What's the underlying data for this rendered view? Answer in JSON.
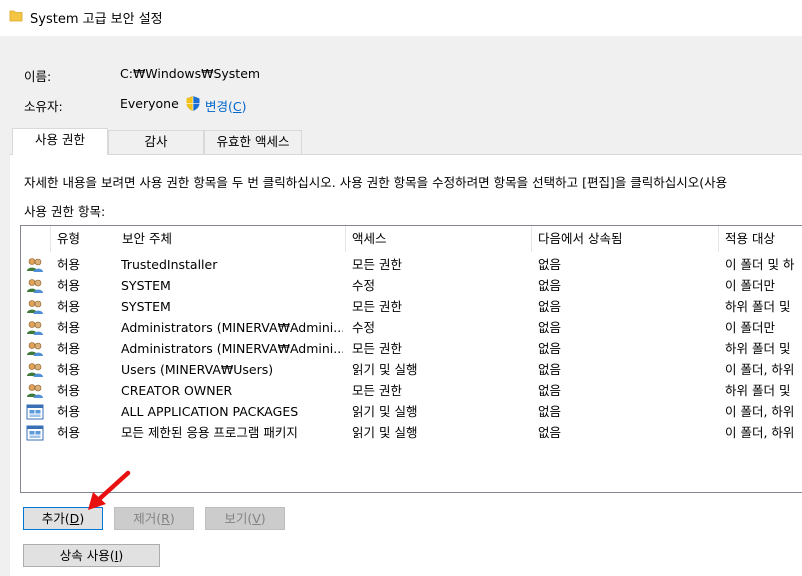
{
  "window": {
    "title": "System 고급 보안 설정"
  },
  "fields": {
    "name_label": "이름:",
    "name_value": "C:₩Windows₩System",
    "owner_label": "소유자:",
    "owner_value": "Everyone",
    "change_text": "변경(",
    "change_key": "C",
    "change_end": ")"
  },
  "tabs": [
    {
      "label": "사용 권한",
      "active": true
    },
    {
      "label": "감사",
      "active": false
    },
    {
      "label": "유효한 액세스",
      "active": false
    }
  ],
  "instruction": "자세한 내용을 보려면 사용 권한 항목을 두 번 클릭하십시오. 사용 권한 항목을 수정하려면 항목을 선택하고 [편집]을 클릭하십시오(사용",
  "list_label": "사용 권한 항목:",
  "columns": [
    "유형",
    "보안 주체",
    "액세스",
    "다음에서 상속됨",
    "적용 대상"
  ],
  "rows": [
    {
      "icon": "users-icon",
      "type": "허용",
      "principal": "TrustedInstaller",
      "access": "모든 권한",
      "inherited": "없음",
      "applies": "이 폴더 및 하"
    },
    {
      "icon": "users-icon",
      "type": "허용",
      "principal": "SYSTEM",
      "access": "수정",
      "inherited": "없음",
      "applies": "이 폴더만"
    },
    {
      "icon": "users-icon",
      "type": "허용",
      "principal": "SYSTEM",
      "access": "모든 권한",
      "inherited": "없음",
      "applies": "하위 폴더 및"
    },
    {
      "icon": "users-icon",
      "type": "허용",
      "principal": "Administrators (MINERVA₩Admini...",
      "access": "수정",
      "inherited": "없음",
      "applies": "이 폴더만"
    },
    {
      "icon": "users-icon",
      "type": "허용",
      "principal": "Administrators (MINERVA₩Admini...",
      "access": "모든 권한",
      "inherited": "없음",
      "applies": "하위 폴더 및"
    },
    {
      "icon": "users-icon",
      "type": "허용",
      "principal": "Users (MINERVA₩Users)",
      "access": "읽기 및 실행",
      "inherited": "없음",
      "applies": "이 폴더, 하위"
    },
    {
      "icon": "users-icon",
      "type": "허용",
      "principal": "CREATOR OWNER",
      "access": "모든 권한",
      "inherited": "없음",
      "applies": "하위 폴더 및"
    },
    {
      "icon": "package-icon",
      "type": "허용",
      "principal": "ALL APPLICATION PACKAGES",
      "access": "읽기 및 실행",
      "inherited": "없음",
      "applies": "이 폴더, 하위"
    },
    {
      "icon": "package-icon",
      "type": "허용",
      "principal": "모든 제한된 응용 프로그램 패키지",
      "access": "읽기 및 실행",
      "inherited": "없음",
      "applies": "이 폴더, 하위"
    }
  ],
  "buttons": {
    "add": {
      "text": "추가(",
      "key": "D",
      "end": ")"
    },
    "remove": {
      "text": "제거(",
      "key": "R",
      "end": ")"
    },
    "view": {
      "text": "보기(",
      "key": "V",
      "end": ")"
    },
    "inherit": {
      "text": "상속 사용(",
      "key": "I",
      "end": ")"
    }
  },
  "colors": {
    "link": "#0066cc",
    "arrow": "#e81010",
    "primary_border": "#0078d7"
  }
}
